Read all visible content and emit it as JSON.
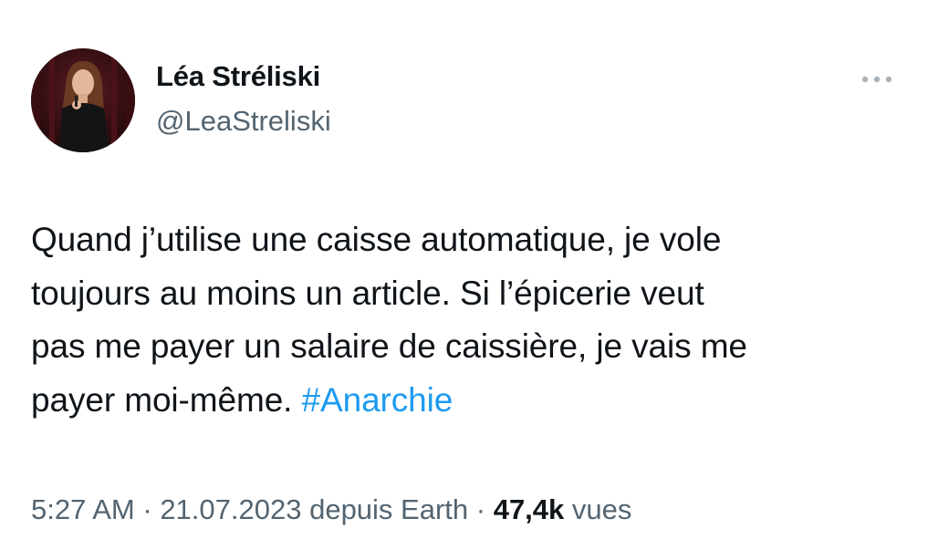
{
  "author": {
    "display_name": "Léa Stréliski",
    "handle": "@LeaStreliski"
  },
  "tweet": {
    "lines": [
      "Quand j’utilise une caisse automatique, je vole",
      "toujours au moins un article. Si l’épicerie veut",
      "pas me payer un salaire de caissière, je vais me",
      "payer moi-même. "
    ],
    "hashtag": "#Anarchie"
  },
  "meta": {
    "time": "5:27 AM",
    "separator": " · ",
    "date": "21.07.2023",
    "source": " depuis Earth",
    "views_count": "47,4k",
    "views_label": " vues"
  },
  "icons": {
    "more": "more-horizontal-icon",
    "avatar": "profile-photo"
  },
  "colors": {
    "text": "#0f1419",
    "secondary": "#536471",
    "link": "#1d9bf0"
  }
}
